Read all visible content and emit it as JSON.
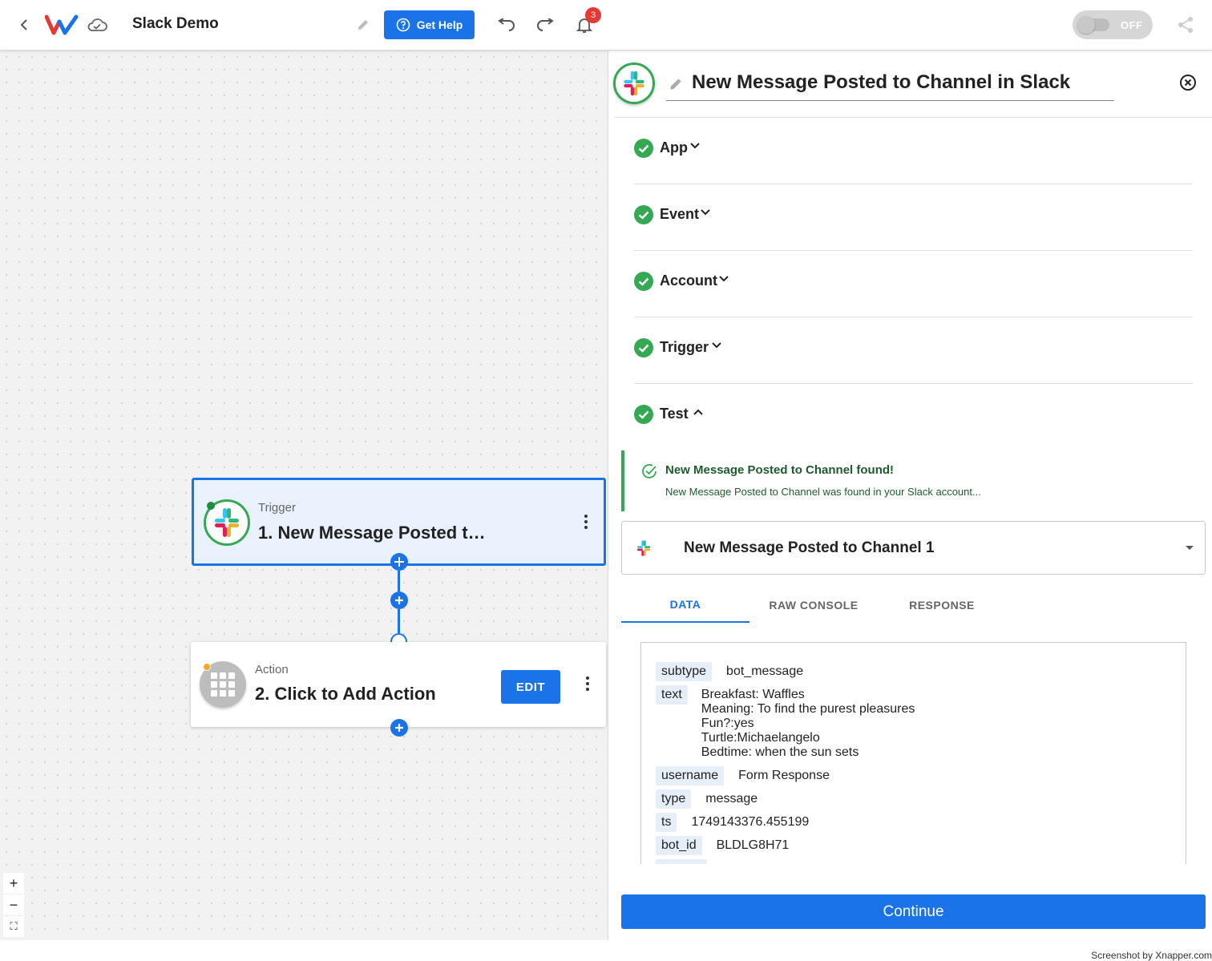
{
  "header": {
    "title": "Slack Demo",
    "help_label": "Get Help",
    "notification_count": "3",
    "toggle_label": "OFF"
  },
  "canvas": {
    "trigger": {
      "kind": "Trigger",
      "name": "1. New Message Posted t…"
    },
    "action": {
      "kind": "Action",
      "name": "2. Click to Add Action",
      "edit_label": "EDIT"
    },
    "zoom": {
      "in": "+",
      "out": "−",
      "fit": "⛶"
    }
  },
  "panel": {
    "title": "New Message Posted to Channel in Slack",
    "sections": [
      {
        "label": "App",
        "expanded": false
      },
      {
        "label": "Event",
        "expanded": false
      },
      {
        "label": "Account",
        "expanded": false
      },
      {
        "label": "Trigger",
        "expanded": false
      },
      {
        "label": "Test",
        "expanded": true
      }
    ],
    "success": {
      "title": "New Message Posted to Channel found!",
      "subtitle": "New Message Posted to Channel was found in your Slack account..."
    },
    "sample_select": "New Message Posted to Channel 1",
    "tabs": [
      {
        "label": "DATA",
        "active": true
      },
      {
        "label": "RAW CONSOLE",
        "active": false
      },
      {
        "label": "RESPONSE",
        "active": false
      }
    ],
    "data": {
      "subtype": {
        "key": "subtype",
        "value": "bot_message"
      },
      "text": {
        "key": "text",
        "lines": [
          "Breakfast: Waffles",
          "Meaning: To find the purest pleasures",
          "Fun?:yes",
          "Turtle:Michaelangelo",
          "Bedtime: when the sun sets"
        ]
      },
      "username": {
        "key": "username",
        "value": "Form Response"
      },
      "type": {
        "key": "type",
        "value": "message"
      },
      "ts": {
        "key": "ts",
        "value": "1749143376.455199"
      },
      "bot_id": {
        "key": "bot_id",
        "value": "BLDLG8H71"
      }
    },
    "continue_label": "Continue"
  },
  "footer": {
    "credit": "Screenshot by Xnapper.com"
  },
  "colors": {
    "accent": "#1a73e8",
    "success": "#34a853",
    "danger": "#e53935",
    "warning": "#f9a825",
    "slack_blue": "#36c5f0",
    "slack_green": "#2eb67d",
    "slack_yellow": "#ecb22e",
    "slack_red": "#e01e5a"
  }
}
